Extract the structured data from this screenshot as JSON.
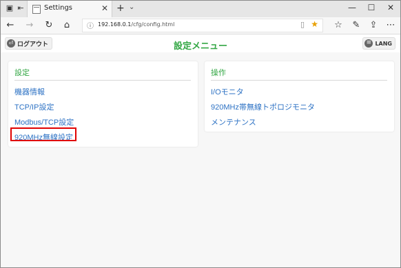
{
  "browser": {
    "tab_title": "Settings",
    "url": "192.168.0.1/cfg/config.html",
    "url_host": "192.168.0.1",
    "url_path": "/cfg/config.html",
    "icons": [
      "tab-manager-icon",
      "set-aside-tabs-icon",
      "page-favicon",
      "close-tab-icon",
      "new-tab-icon",
      "tab-list-icon",
      "minimize-icon",
      "maximize-icon",
      "close-window-icon",
      "back-icon",
      "forward-icon",
      "refresh-icon",
      "home-icon",
      "info-icon",
      "reading-view-icon",
      "favorite-star-icon",
      "favorites-hub-icon",
      "notes-icon",
      "share-icon",
      "more-icon"
    ],
    "accent_star_color": "#e8a000"
  },
  "header": {
    "logout_label": "ログアウト",
    "title": "設定メニュー",
    "lang_label": "LANG"
  },
  "settings_panel": {
    "title": "設定",
    "items": [
      "機器情報",
      "TCP/IP設定",
      "Modbus/TCP設定",
      "920MHz無線設定"
    ],
    "highlighted_item": "920MHz無線設定"
  },
  "operations_panel": {
    "title": "操作",
    "items": [
      "I/Oモニタ",
      "920MHz帯無線トポロジモニタ",
      "メンテナンス"
    ]
  },
  "colors": {
    "title_green": "#34a745",
    "link_blue": "#2d72c4",
    "highlight_red": "#e00000"
  }
}
